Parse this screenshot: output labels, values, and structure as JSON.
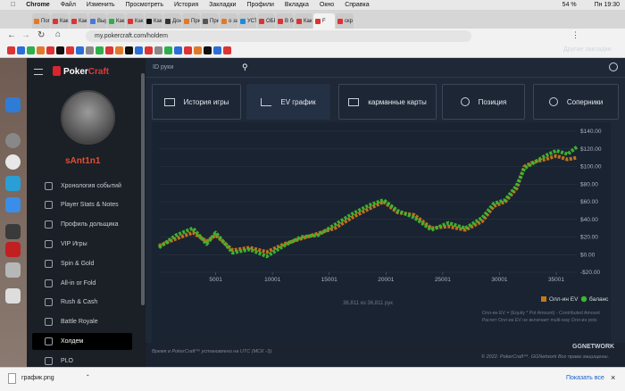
{
  "menubar": {
    "app": "Chrome",
    "items": [
      "Файл",
      "Изменить",
      "Просмотреть",
      "История",
      "Закладки",
      "Профили",
      "Вкладка",
      "Окно",
      "Справка"
    ],
    "battery": "54 %",
    "clock": "Пн 19:30"
  },
  "tabs": [
    "Пог",
    "Как",
    "Как",
    "Выр",
    "Как",
    "Как",
    "Как",
    "Дон",
    "При",
    "При",
    "о за",
    "УСТ",
    "ОБР",
    "В бо",
    "Как",
    "F",
    "скр"
  ],
  "address": {
    "url": "my.pokercraft.com/holdem",
    "other_bookmarks": "Другие закладки"
  },
  "sidebar": {
    "brand_a": "Poker",
    "brand_b": "Craft",
    "username": "sAnt1n1",
    "items": [
      "Хронология событий",
      "Player Stats & Notes",
      "Профиль дольщика",
      "VIP Игры",
      "Spin & Gold",
      "All-in or Fold",
      "Rush & Cash",
      "Battle Royale",
      "Холдем",
      "PLO"
    ],
    "active_item": "Холдем"
  },
  "header": {
    "search_placeholder": "ID руки"
  },
  "tabs_main": [
    "История игры",
    "EV график",
    "карманные карты",
    "Позиция",
    "Соперники"
  ],
  "chart_data": {
    "type": "line",
    "x_ticks": [
      "5001",
      "10001",
      "15001",
      "20001",
      "25001",
      "30001",
      "35001"
    ],
    "y_ticks": [
      "$140.00",
      "$120.00",
      "$100.00",
      "$80.00",
      "$60.00",
      "$40.00",
      "$20.00",
      "$0.00",
      "-$20.00"
    ],
    "ylim": [
      -20,
      140
    ],
    "xlim": [
      0,
      36811
    ],
    "series": [
      {
        "name": "Олл-ин EV",
        "color": "#c8761c",
        "x": [
          0,
          1500,
          3000,
          4200,
          5000,
          6500,
          8000,
          9500,
          11000,
          12500,
          14000,
          15500,
          17000,
          18500,
          19800,
          21000,
          22500,
          24000,
          25500,
          27000,
          28500,
          29500,
          30500,
          31500,
          32200,
          33000,
          34000,
          35000,
          36000,
          36811
        ],
        "values": [
          10,
          18,
          25,
          15,
          22,
          5,
          8,
          3,
          12,
          18,
          24,
          30,
          42,
          52,
          60,
          48,
          45,
          30,
          32,
          28,
          38,
          55,
          60,
          75,
          100,
          105,
          108,
          112,
          108,
          110
        ]
      },
      {
        "name": "баланс",
        "color": "#3fb72e",
        "x": [
          0,
          1500,
          3000,
          4200,
          5000,
          6500,
          8000,
          9500,
          11000,
          12500,
          14000,
          15500,
          17000,
          18500,
          19800,
          21000,
          22500,
          24000,
          25500,
          27000,
          28500,
          29500,
          30500,
          31500,
          32200,
          33000,
          34000,
          35000,
          36000,
          36811
        ],
        "values": [
          8,
          22,
          30,
          12,
          25,
          2,
          6,
          -2,
          10,
          20,
          22,
          34,
          46,
          56,
          62,
          50,
          42,
          28,
          36,
          30,
          42,
          58,
          62,
          78,
          98,
          104,
          112,
          118,
          114,
          122
        ]
      }
    ],
    "counter": "36,811 из 36,811 рук",
    "legend_position": "bottom-right",
    "note1": "Олл-ин EV = (Equity * Pot Amount) - Contributed Amount",
    "note2": "Расчет Олл-ин EV не включает multi-way Олл-ин pots"
  },
  "footer": {
    "tz": "Время в PokerCraft™ установлено на UTC (MCK -3).",
    "brand": "GGNETWORK",
    "copy": "© 2022. PokerCraft™. GGNetwork Все права защищены."
  },
  "download": {
    "file": "график.png",
    "show_all": "Показать все"
  }
}
